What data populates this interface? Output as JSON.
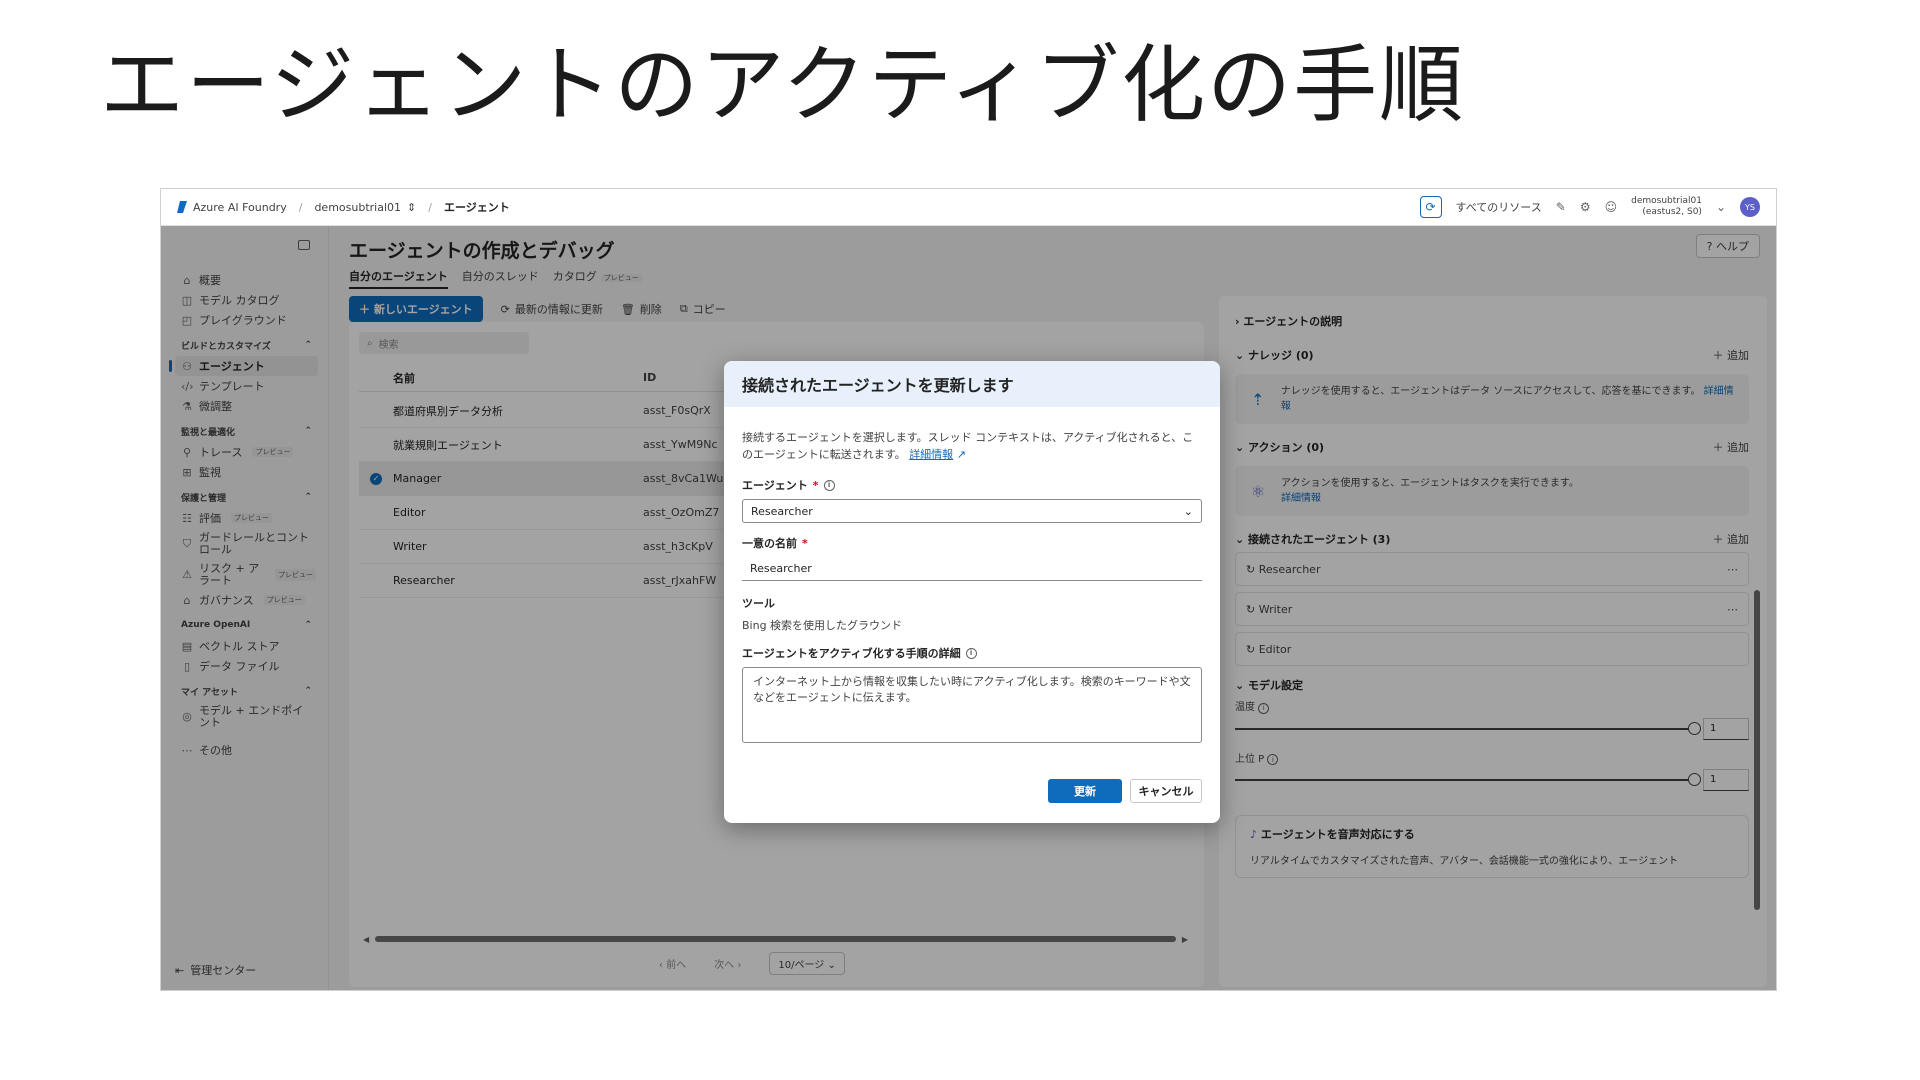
{
  "slide": {
    "title": "エージェントのアクティブ化の手順"
  },
  "topbar": {
    "brand": "Azure AI Foundry",
    "project": "demosubtrial01",
    "page": "エージェント",
    "all_resources": "すべてのリソース",
    "account_line1": "demosubtrial01",
    "account_line2": "(eastus2, S0)",
    "avatar_initials": "YS"
  },
  "sidebar": {
    "top_items": [
      {
        "label": "概要",
        "icon": "home-icon"
      },
      {
        "label": "モデル カタログ",
        "icon": "catalog-icon"
      },
      {
        "label": "プレイグラウンド",
        "icon": "playground-icon"
      }
    ],
    "sections": [
      {
        "title": "ビルドとカスタマイズ",
        "items": [
          {
            "label": "エージェント",
            "active": true,
            "icon": "agent-icon"
          },
          {
            "label": "テンプレート",
            "icon": "template-icon"
          },
          {
            "label": "微調整",
            "icon": "tune-icon"
          }
        ]
      },
      {
        "title": "監視と最適化",
        "items": [
          {
            "label": "トレース",
            "tag": "プレビュー",
            "icon": "trace-icon"
          },
          {
            "label": "監視",
            "icon": "monitor-icon"
          }
        ]
      },
      {
        "title": "保護と管理",
        "items": [
          {
            "label": "評価",
            "tag": "プレビュー",
            "icon": "eval-icon"
          },
          {
            "label": "ガードレールとコントロール",
            "icon": "shield-icon"
          },
          {
            "label": "リスク + アラート",
            "tag": "プレビュー",
            "icon": "risk-icon"
          },
          {
            "label": "ガバナンス",
            "tag": "プレビュー",
            "icon": "governance-icon"
          }
        ]
      },
      {
        "title": "Azure OpenAI",
        "items": [
          {
            "label": "ベクトル ストア",
            "icon": "vector-icon"
          },
          {
            "label": "データ ファイル",
            "icon": "file-icon"
          }
        ]
      },
      {
        "title": "マイ アセット",
        "items": [
          {
            "label": "モデル + エンドポイント",
            "icon": "model-icon"
          }
        ]
      }
    ],
    "more": "その他",
    "management_center": "管理センター"
  },
  "content": {
    "title": "エージェントの作成とデバッグ",
    "help": "ヘルプ",
    "tabs": [
      "自分のエージェント",
      "自分のスレッド",
      "カタログ"
    ],
    "catalog_tag": "プレビュー",
    "toolbar": {
      "new_agent": "新しいエージェント",
      "refresh": "最新の情報に更新",
      "delete": "削除",
      "copy": "コピー"
    },
    "search_placeholder": "検索",
    "table": {
      "headers": [
        "名前",
        "ID"
      ],
      "rows": [
        {
          "name": "都道府県別データ分析",
          "id": "asst_F0sQrX",
          "selected": false
        },
        {
          "name": "就業規則エージェント",
          "id": "asst_YwM9Nc",
          "selected": false
        },
        {
          "name": "Manager",
          "id": "asst_8vCa1Wu",
          "selected": true
        },
        {
          "name": "Editor",
          "id": "asst_OzOmZ7",
          "selected": false
        },
        {
          "name": "Writer",
          "id": "asst_h3cKpV",
          "selected": false
        },
        {
          "name": "Researcher",
          "id": "asst_rJxahFW",
          "selected": false
        }
      ]
    },
    "pager": {
      "prev": "前へ",
      "next": "次へ",
      "size": "10/ページ"
    }
  },
  "rpanel": {
    "description": "エージェントの説明",
    "knowledge": {
      "title": "ナレッジ (0)",
      "add": "追加",
      "text": "ナレッジを使用すると、エージェントはデータ ソースにアクセスして、応答を基にできます。",
      "link": "詳細情報"
    },
    "actions": {
      "title": "アクション (0)",
      "add": "追加",
      "text": "アクションを使用すると、エージェントはタスクを実行できます。",
      "link": "詳細情報"
    },
    "connected": {
      "title": "接続されたエージェント (3)",
      "add": "追加",
      "items": [
        "Researcher",
        "Writer",
        "Editor"
      ]
    },
    "model_settings": "モデル設定",
    "temperature": {
      "label": "温度",
      "value": "1"
    },
    "top_p": {
      "label": "上位 P",
      "value": "1"
    },
    "voice": {
      "title": "エージェントを音声対応にする",
      "text": "リアルタイムでカスタマイズされた音声、アバター、会話機能一式の強化により、エージェント"
    }
  },
  "dialog": {
    "title": "接続されたエージェントを更新します",
    "description": "接続するエージェントを選択します。スレッド コンテキストは、アクティブ化されると、このエージェントに転送されます。",
    "learn_more": "詳細情報",
    "agent_label": "エージェント",
    "agent_value": "Researcher",
    "unique_name_label": "一意の名前",
    "unique_name_value": "Researcher",
    "tools_label": "ツール",
    "tools_value": "Bing 検索を使用したグラウンド",
    "activation_label": "エージェントをアクティブ化する手順の詳細",
    "activation_value": "インターネット上から情報を収集したい時にアクティブ化します。検索のキーワードや文などをエージェントに伝えます。",
    "update": "更新",
    "cancel": "キャンセル"
  }
}
